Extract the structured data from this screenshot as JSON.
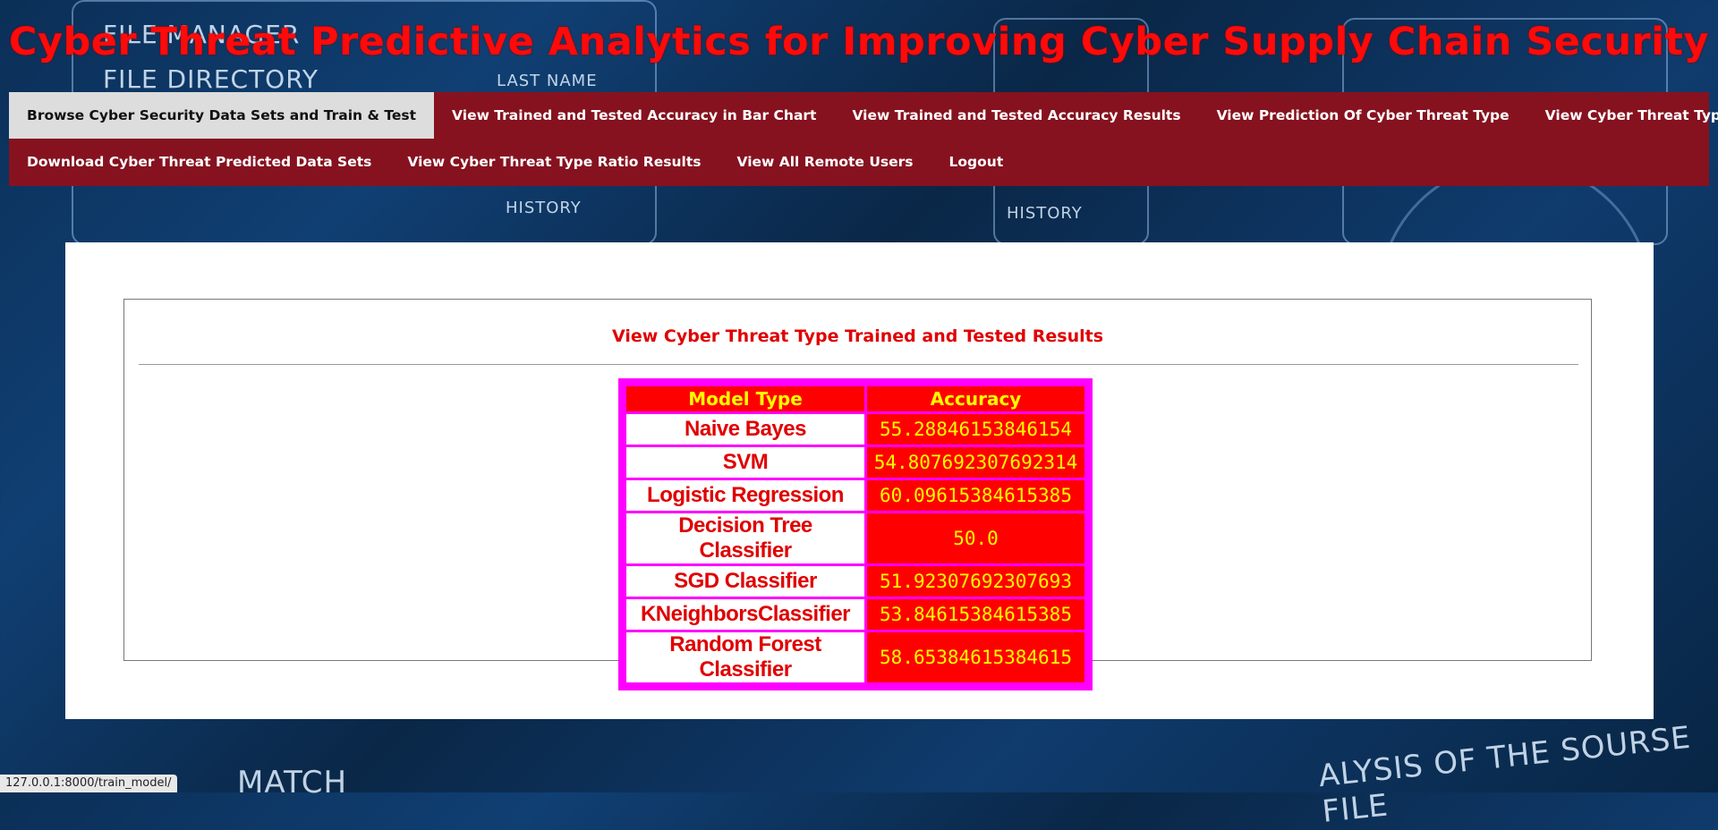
{
  "site": {
    "title": "Cyber Threat Predictive Analytics for Improving Cyber Supply Chain Security"
  },
  "background_text": {
    "file_manager": "FILE MANAGER",
    "file_directory": "FILE DIRECTORY",
    "last_name": "LAST NAME",
    "history": "HISTORY",
    "match": "MATCH",
    "source_file": "ALYSIS OF THE SOURSE FILE"
  },
  "nav": {
    "row1": [
      {
        "label": "Browse Cyber Security Data Sets and Train & Test",
        "active": true
      },
      {
        "label": "View Trained and Tested Accuracy in Bar Chart",
        "active": false
      },
      {
        "label": "View Trained and Tested Accuracy Results",
        "active": false
      },
      {
        "label": "View Prediction Of Cyber Threat Type",
        "active": false
      },
      {
        "label": "View Cyber Threat Type Ratio",
        "active": false
      }
    ],
    "row2": [
      {
        "label": "Download Cyber Threat Predicted Data Sets",
        "active": false
      },
      {
        "label": "View Cyber Threat Type Ratio Results",
        "active": false
      },
      {
        "label": "View All Remote Users",
        "active": false
      },
      {
        "label": "Logout",
        "active": false
      }
    ]
  },
  "results": {
    "heading": "View Cyber Threat Type Trained and Tested Results",
    "columns": [
      "Model Type",
      "Accuracy"
    ],
    "rows": [
      {
        "model": "Naive Bayes",
        "accuracy": "55.28846153846154"
      },
      {
        "model": "SVM",
        "accuracy": "54.807692307692314"
      },
      {
        "model": "Logistic Regression",
        "accuracy": "60.09615384615385"
      },
      {
        "model": "Decision Tree Classifier",
        "accuracy": "50.0"
      },
      {
        "model": "SGD Classifier",
        "accuracy": "51.92307692307693"
      },
      {
        "model": "KNeighborsClassifier",
        "accuracy": "53.84615384615385"
      },
      {
        "model": "Random Forest Classifier",
        "accuracy": "58.65384615384615"
      }
    ]
  },
  "status_bar": {
    "url": "127.0.0.1:8000/train_model/"
  },
  "colors": {
    "nav_bg": "#86121f",
    "title_red": "#ff0a0a",
    "table_border": "#ff00ff",
    "cell_red": "#ff0000",
    "cell_yellow_text": "#ffff00"
  }
}
